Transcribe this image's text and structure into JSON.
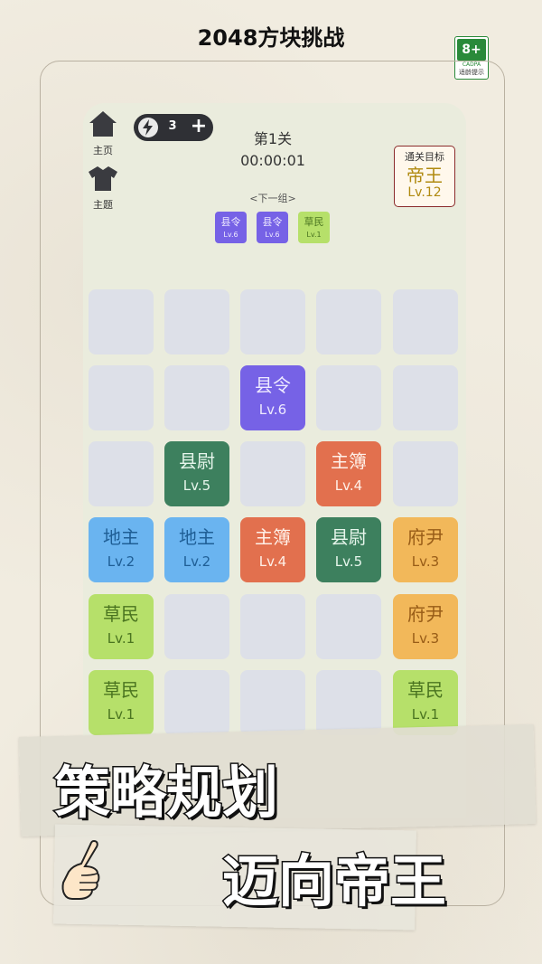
{
  "app_title": "2048方块挑战",
  "age_badge": {
    "age": "8+",
    "org": "CADPA",
    "tip": "适龄提示"
  },
  "sidebar": {
    "home_label": "主页",
    "theme_label": "主题"
  },
  "energy": {
    "count": "3",
    "plus": "+"
  },
  "level": {
    "title": "第1关",
    "timer": "00:00:01"
  },
  "goal": {
    "label": "通关目标",
    "name": "帝王",
    "lv": "Lv.12",
    "color": "#b08a10"
  },
  "next_group": {
    "label": "<下一组>",
    "pieces": [
      {
        "name": "县令",
        "lv": "Lv.6"
      },
      {
        "name": "县令",
        "lv": "Lv.6"
      },
      {
        "name": "草民",
        "lv": "Lv.1"
      }
    ]
  },
  "board": {
    "rows": [
      [
        null,
        null,
        null,
        null,
        null
      ],
      [
        null,
        null,
        {
          "name": "县令",
          "lv": "Lv.6"
        },
        null,
        null
      ],
      [
        null,
        {
          "name": "县尉",
          "lv": "Lv.5"
        },
        null,
        {
          "name": "主簿",
          "lv": "Lv.4"
        },
        null
      ],
      [
        {
          "name": "地主",
          "lv": "Lv.2"
        },
        {
          "name": "地主",
          "lv": "Lv.2"
        },
        {
          "name": "主簿",
          "lv": "Lv.4"
        },
        {
          "name": "县尉",
          "lv": "Lv.5"
        },
        {
          "name": "府尹",
          "lv": "Lv.3"
        }
      ],
      [
        {
          "name": "草民",
          "lv": "Lv.1"
        },
        null,
        null,
        null,
        {
          "name": "府尹",
          "lv": "Lv.3"
        }
      ],
      [
        {
          "name": "草民",
          "lv": "Lv.1"
        },
        null,
        null,
        null,
        {
          "name": "草民",
          "lv": "Lv.1"
        }
      ]
    ]
  },
  "level_colors": {
    "lv1": "#b6e06a",
    "lv2": "#6ab4f0",
    "lv3": "#f2b85a",
    "lv4": "#e2704e",
    "lv5": "#3d805e",
    "lv6": "#7662e6"
  },
  "slogans": {
    "line1": "策略规划",
    "line2": "迈向帝王"
  }
}
